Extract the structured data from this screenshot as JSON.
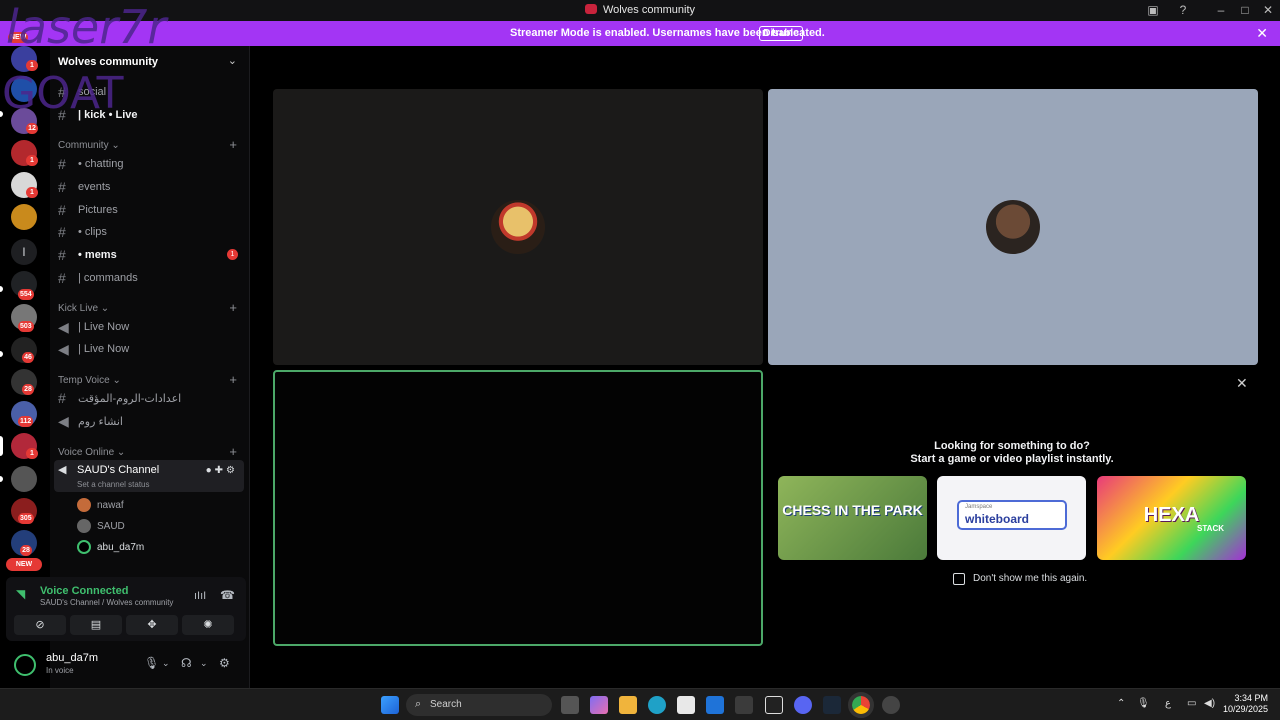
{
  "window": {
    "title": "Wolves community"
  },
  "banner": {
    "text": "Streamer Mode is enabled. Usernames have been truncated.",
    "button": "Disable"
  },
  "overlay": {
    "line1": "laser7r",
    "line2": "GOAT"
  },
  "rail": {
    "badges": [
      "NEW",
      "1",
      "12",
      "1",
      "1",
      "554",
      "503",
      "46",
      "28",
      "112",
      "1",
      "305",
      "28",
      "NEW"
    ],
    "letter": "l"
  },
  "server": {
    "name": "Wolves community"
  },
  "channels_top": [
    {
      "label": "social"
    },
    {
      "label": "| kick • Live"
    }
  ],
  "categories": {
    "community": "Community",
    "kick_live": "Kick Live",
    "temp_voice": "Temp Voice",
    "voice_online": "Voice Online"
  },
  "community_channels": [
    {
      "label": "• chatting"
    },
    {
      "label": "events"
    },
    {
      "label": "Pictures"
    },
    {
      "label": "• clips"
    },
    {
      "label": "• mems",
      "badge": "1"
    },
    {
      "label": "| commands"
    }
  ],
  "kick_channels": [
    {
      "label": "| Live Now"
    },
    {
      "label": "| Live Now"
    }
  ],
  "temp_channels": [
    {
      "label": "اعدادات-الروم-المؤقت"
    },
    {
      "label": "انشاء روم"
    }
  ],
  "voice_channel": {
    "name": "SAUD's Channel",
    "status": "Set a channel status"
  },
  "voice_users": [
    "nawaf",
    "SAUD",
    "abu_da7m"
  ],
  "voice_panel": {
    "title": "Voice Connected",
    "subtitle": "SAUD's Channel / Wolves community"
  },
  "user": {
    "name": "abu_da7m",
    "status": "In voice"
  },
  "activity": {
    "line1": "Looking for something to do?",
    "line2": "Start a game or video playlist instantly.",
    "cards": [
      {
        "title": "CHESS IN THE PARK"
      },
      {
        "title": "whiteboard",
        "brand": "Jamspace"
      },
      {
        "title": "HEXA",
        "sub": "STACK"
      }
    ],
    "checkbox": "Don't show me this again."
  },
  "taskbar": {
    "search": "Search",
    "time": "3:34 PM",
    "date": "10/29/2025",
    "lang": "ع"
  },
  "colors": {
    "accent": "#a335f4",
    "voice_green": "#3fbf6e",
    "badge_red": "#e53935"
  }
}
